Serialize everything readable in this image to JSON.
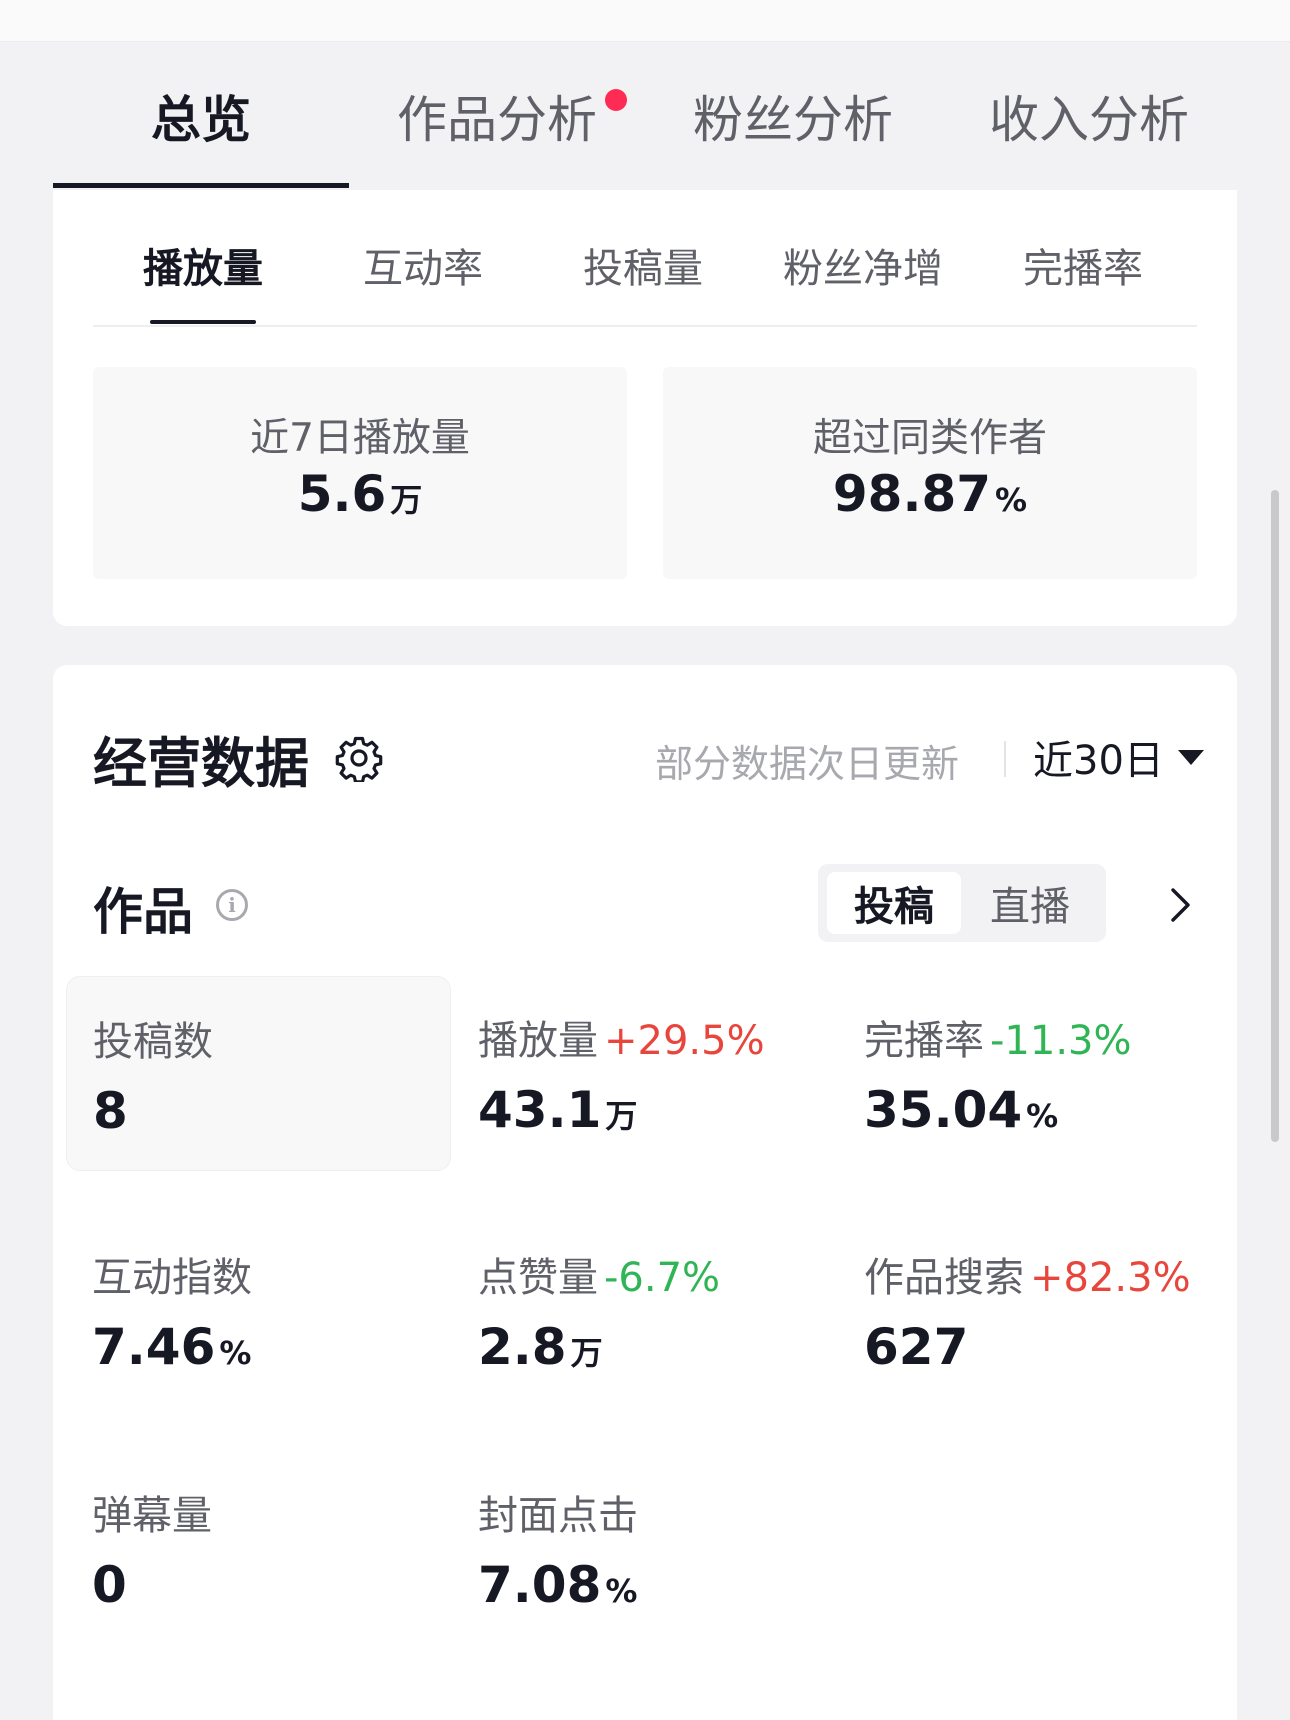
{
  "main_tabs": [
    {
      "label": "总览",
      "active": true
    },
    {
      "label": "作品分析",
      "active": false,
      "has_dot": true
    },
    {
      "label": "粉丝分析",
      "active": false
    },
    {
      "label": "收入分析",
      "active": false
    }
  ],
  "sub_tabs": [
    {
      "label": "播放量",
      "active": true
    },
    {
      "label": "互动率",
      "active": false
    },
    {
      "label": "投稿量",
      "active": false
    },
    {
      "label": "粉丝净增",
      "active": false
    },
    {
      "label": "完播率",
      "active": false
    }
  ],
  "summary": {
    "left": {
      "label": "近7日播放量",
      "value": "5.6",
      "unit": "万"
    },
    "right": {
      "label": "超过同类作者",
      "value": "98.87",
      "unit": "%"
    }
  },
  "business": {
    "title": "经营数据",
    "gear_icon": "gear-icon",
    "note": "部分数据次日更新",
    "range": "近30日"
  },
  "works": {
    "title": "作品",
    "segment": {
      "active": "投稿",
      "inactive": "直播"
    },
    "metrics": [
      {
        "label": "投稿数",
        "delta": "",
        "trend": "",
        "value": "8",
        "unit": "",
        "highlight": true
      },
      {
        "label": "播放量",
        "delta": "+29.5%",
        "trend": "up",
        "value": "43.1",
        "unit": "万"
      },
      {
        "label": "完播率",
        "delta": "-11.3%",
        "trend": "down",
        "value": "35.04",
        "unit": "%"
      },
      {
        "label": "互动指数",
        "delta": "",
        "trend": "",
        "value": "7.46",
        "unit": "%"
      },
      {
        "label": "点赞量",
        "delta": "-6.7%",
        "trend": "down",
        "value": "2.8",
        "unit": "万"
      },
      {
        "label": "作品搜索",
        "delta": "+82.3%",
        "trend": "up",
        "value": "627",
        "unit": ""
      },
      {
        "label": "弹幕量",
        "delta": "",
        "trend": "",
        "value": "0",
        "unit": ""
      },
      {
        "label": "封面点击",
        "delta": "",
        "trend": "",
        "value": "7.08",
        "unit": "%"
      }
    ]
  },
  "colors": {
    "accent_red": "#fe2c55",
    "up": "#e8453c",
    "down": "#2fb555",
    "text": "#161823",
    "muted": "#5f6068"
  }
}
